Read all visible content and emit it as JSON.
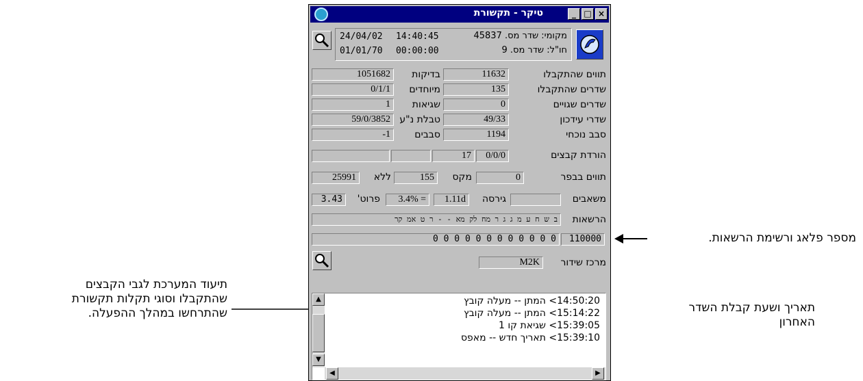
{
  "window": {
    "title": "טיקר - תקשורת"
  },
  "header": {
    "local_line": "מקומי: שדר מס. 45837",
    "local_time": "14:40:45",
    "local_date": "24/04/02",
    "remote_line": "חו\"ל: שדר מס. 9",
    "remote_time": "00:00:00",
    "remote_date": "01/01/70"
  },
  "stats": {
    "received_chars_label": "תווים שהתקבלו",
    "received_chars_value": "11632",
    "checks_label": "בדיקות",
    "checks_value": "1051682",
    "received_msgs_label": "שדרים שהתקבלו",
    "received_msgs_value": "135",
    "special_label": "מיוחדים",
    "special_value": "0/1/1",
    "bad_msgs_label": "שדרים שגויים",
    "bad_msgs_value": "0",
    "errors_label": "שגיאות",
    "errors_value": "1",
    "update_msgs_label": "שדרי עידכון",
    "update_msgs_value": "49/33",
    "table_label": "טבלת נ\"ע",
    "table_value": "59/0/3852",
    "current_cause_label": "סבב נוכחי",
    "current_cause_value": "1194",
    "causes_label": "סבבים",
    "causes_value": "-1",
    "download_label": "הורדת קבצים",
    "download_value1": "0/0/0",
    "download_value2": "17",
    "download_value3": "",
    "download_value4": "",
    "buffer_label": "תווים בבפר",
    "buffer_value": "0",
    "max_label": "מקס",
    "max_value": "155",
    "without_label": "ללא",
    "without_value": "25991",
    "resources_label": "משאבים",
    "resources_value": "",
    "version_label": "גירסה",
    "version_value": "1.11d",
    "eq_value": "3.4% =",
    "detail_label": "פרוט'",
    "detail_value": "3.43"
  },
  "permissions": {
    "label": "הרשאות",
    "letters": "ב  ש  ח  ע  מ ג  ג ר מח לק מא - - ר ט אמ קר",
    "flag_value": "110000",
    "bits": "0  0  0  0  0  0  0  0  0  0  0  0"
  },
  "center": {
    "label": "מרכז שידור",
    "value": "M2K"
  },
  "log": [
    "14:50:20> המתן -- מעלה קובץ",
    "15:14:22> המתן -- מעלה קובץ",
    "15:39:05> שגיאת קו 1",
    "15:39:10> תאריך חדש -- מאפס"
  ],
  "annotations": {
    "right_top": "מספר פלאג ורשימת הרשאות.",
    "left_line1": "תיעוד המערכת לגבי הקבצים",
    "left_line2": "שהתקבלו וסוגי תקלות תקשורת",
    "left_line3": "שהתרחשו במהלך ההפעלה.",
    "right_line1": "תאריך ושעת קבלת השדר",
    "right_line2": "האחרון"
  },
  "icons": {
    "zoom": "magnifier-icon",
    "app": "ticker-app-icon",
    "phone": "phone-icon"
  }
}
